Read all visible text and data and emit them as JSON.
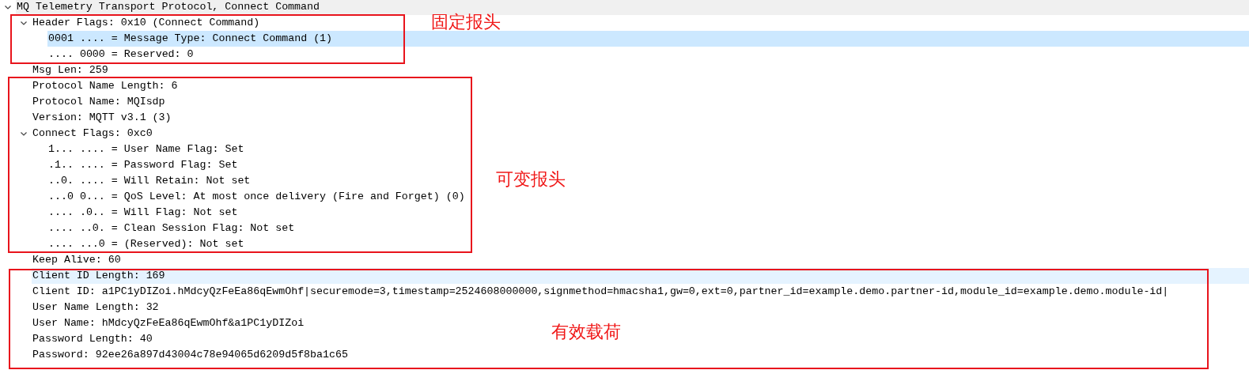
{
  "tree": [
    {
      "kind": "protocol",
      "text": "MQ Telemetry Transport Protocol, Connect Command",
      "expanded": true,
      "selected": false,
      "hovered": false,
      "children": [
        {
          "kind": "field",
          "text": "Header Flags: 0x10 (Connect Command)",
          "expanded": true,
          "selected": false,
          "hovered": false,
          "children": [
            {
              "kind": "field",
              "text": "0001 .... = Message Type: Connect Command (1)",
              "selected": true,
              "hovered": false
            },
            {
              "kind": "field",
              "text": ".... 0000 = Reserved: 0",
              "selected": false,
              "hovered": false
            }
          ]
        },
        {
          "kind": "field",
          "text": "Msg Len: 259",
          "selected": false,
          "hovered": false
        },
        {
          "kind": "field",
          "text": "Protocol Name Length: 6",
          "selected": false,
          "hovered": false
        },
        {
          "kind": "field",
          "text": "Protocol Name: MQIsdp",
          "selected": false,
          "hovered": false
        },
        {
          "kind": "field",
          "text": "Version: MQTT v3.1 (3)",
          "selected": false,
          "hovered": false
        },
        {
          "kind": "field",
          "text": "Connect Flags: 0xc0",
          "expanded": true,
          "selected": false,
          "hovered": false,
          "children": [
            {
              "kind": "field",
              "text": "1... .... = User Name Flag: Set",
              "selected": false,
              "hovered": false
            },
            {
              "kind": "field",
              "text": ".1.. .... = Password Flag: Set",
              "selected": false,
              "hovered": false
            },
            {
              "kind": "field",
              "text": "..0. .... = Will Retain: Not set",
              "selected": false,
              "hovered": false
            },
            {
              "kind": "field",
              "text": "...0 0... = QoS Level: At most once delivery (Fire and Forget) (0)",
              "selected": false,
              "hovered": false
            },
            {
              "kind": "field",
              "text": ".... .0.. = Will Flag: Not set",
              "selected": false,
              "hovered": false
            },
            {
              "kind": "field",
              "text": ".... ..0. = Clean Session Flag: Not set",
              "selected": false,
              "hovered": false
            },
            {
              "kind": "field",
              "text": ".... ...0 = (Reserved): Not set",
              "selected": false,
              "hovered": false
            }
          ]
        },
        {
          "kind": "field",
          "text": "Keep Alive: 60",
          "selected": false,
          "hovered": false
        },
        {
          "kind": "field",
          "text": "Client ID Length: 169",
          "selected": false,
          "hovered": true
        },
        {
          "kind": "field",
          "text": "Client ID: a1PC1yDIZoi.hMdcyQzFeEa86qEwmOhf|securemode=3,timestamp=2524608000000,signmethod=hmacsha1,gw=0,ext=0,partner_id=example.demo.partner-id,module_id=example.demo.module-id|",
          "selected": false,
          "hovered": false
        },
        {
          "kind": "field",
          "text": "User Name Length: 32",
          "selected": false,
          "hovered": false
        },
        {
          "kind": "field",
          "text": "User Name: hMdcyQzFeEa86qEwmOhf&a1PC1yDIZoi",
          "selected": false,
          "hovered": false
        },
        {
          "kind": "field",
          "text": "Password Length: 40",
          "selected": false,
          "hovered": false
        },
        {
          "kind": "field",
          "text": "Password: 92ee26a897d43004c78e94065d6209d5f8ba1c65",
          "selected": false,
          "hovered": false
        }
      ]
    }
  ],
  "annotations": [
    {
      "label": "固定报头"
    },
    {
      "label": "可变报头"
    },
    {
      "label": "有效载荷"
    }
  ]
}
